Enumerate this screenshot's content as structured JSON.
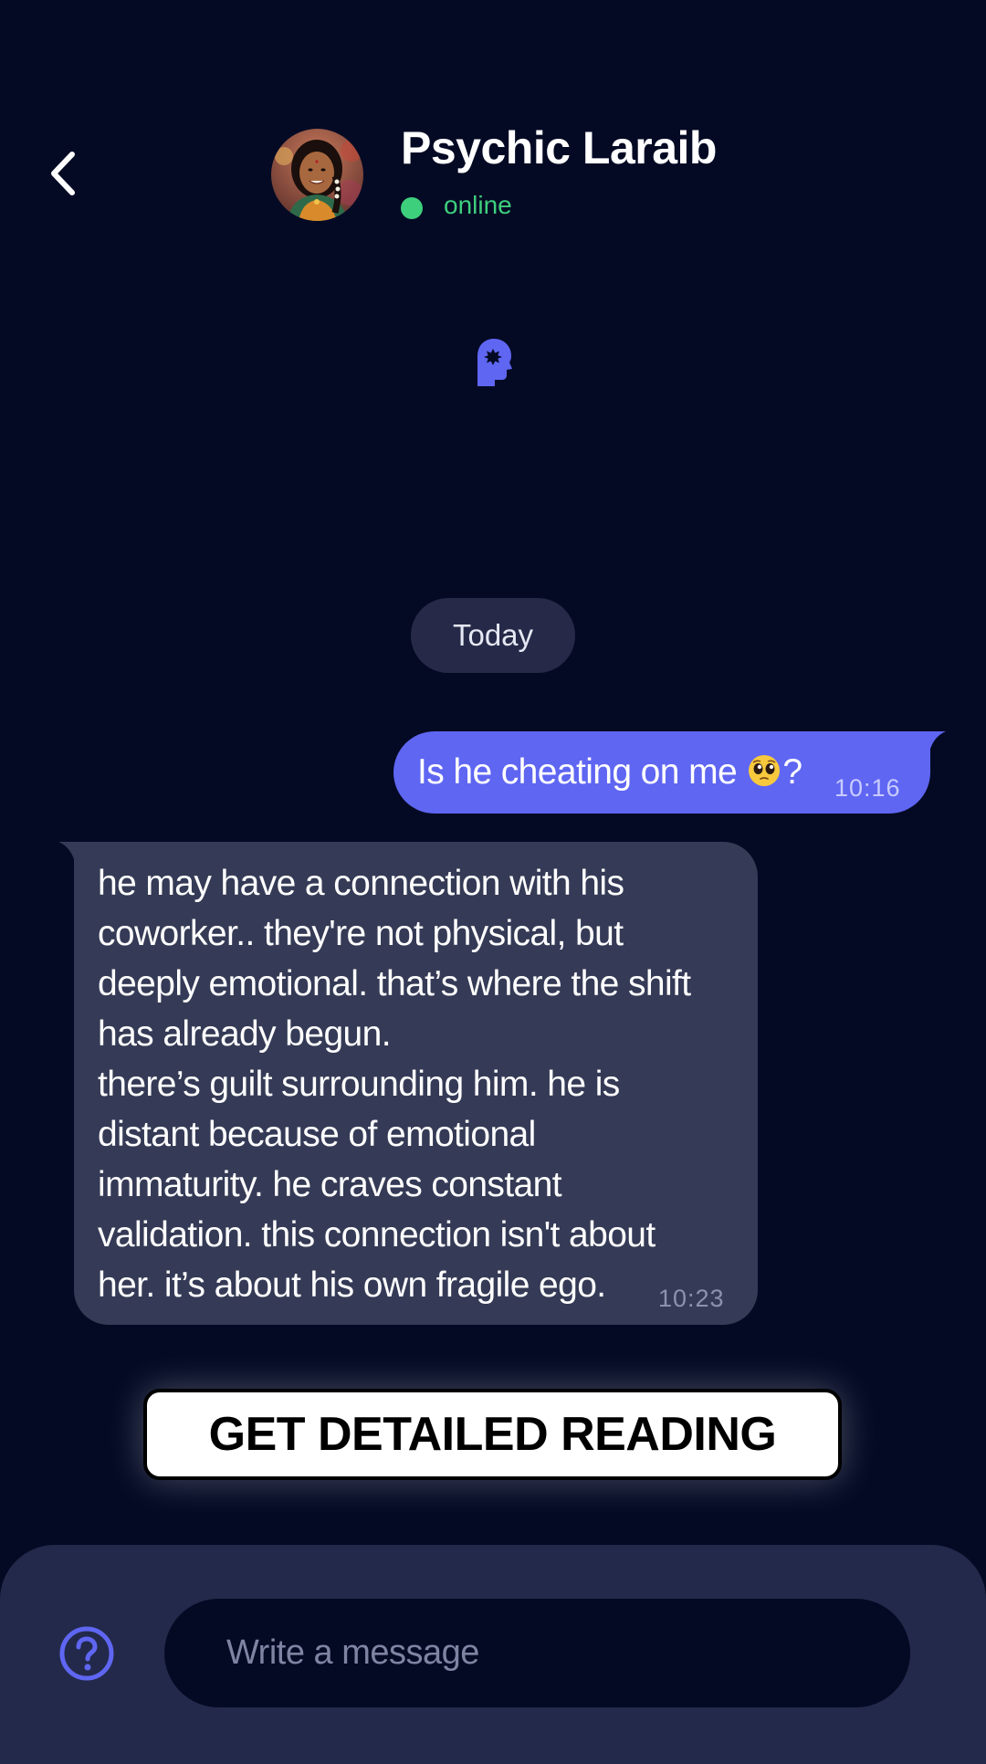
{
  "header": {
    "contact_name": "Psychic Laraib",
    "status": "online"
  },
  "date_divider": "Today",
  "messages": [
    {
      "direction": "outgoing",
      "text_before_emoji": "Is he cheating on me",
      "emoji": "pleading-face",
      "text_after_emoji": "?",
      "time": "10:16"
    },
    {
      "direction": "incoming",
      "text": "he may have a connection with his\ncoworker.. they're not physical, but\ndeeply emotional. that’s where the shift\nhas already begun.\nthere’s guilt surrounding him. he is\ndistant because of emotional\nimmaturity. he craves constant\nvalidation. this connection isn't about\nher. it’s about his own fragile ego.",
      "time": "10:23"
    }
  ],
  "cta": {
    "label": "GET DETAILED READING"
  },
  "composer": {
    "placeholder": "Write a message",
    "value": ""
  },
  "icons": {
    "back": "chevron-left-icon",
    "logo": "psychic-head-logo-icon",
    "help": "question-circle-icon",
    "emoji": "pleading-face-icon"
  },
  "colors": {
    "background": "#040a24",
    "accent": "#5f66f2",
    "incoming_bubble": "#353b56",
    "online": "#3ecf7c",
    "composer": "#23294a"
  }
}
